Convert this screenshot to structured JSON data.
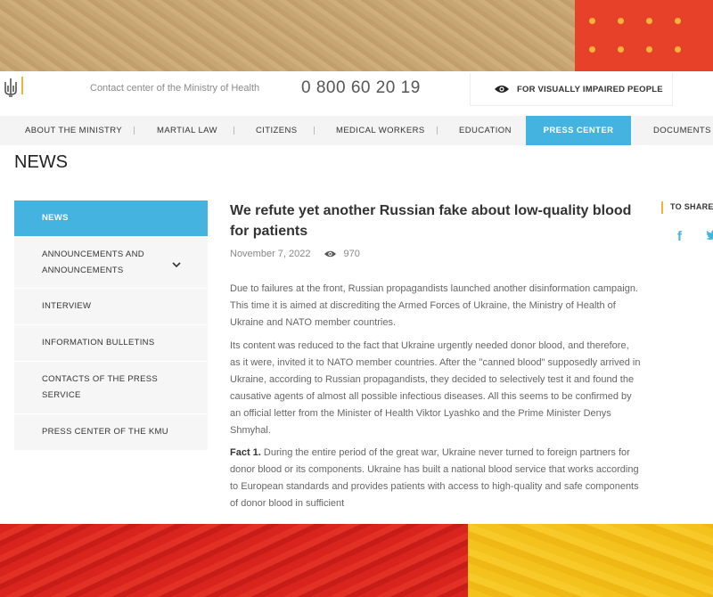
{
  "header": {
    "contact_label": "Contact center of the Ministry of Health",
    "phone": "0 800 60 20 19",
    "visually_impaired": "FOR VISUALLY IMPAIRED PEOPLE"
  },
  "nav": {
    "items": [
      "ABOUT THE MINISTRY",
      "MARTIAL LAW",
      "CITIZENS",
      "MEDICAL WORKERS",
      "EDUCATION",
      "PRESS CENTER",
      "DOCUMENTS"
    ],
    "active": "PRESS CENTER"
  },
  "page_title": "NEWS",
  "sidebar": {
    "items": [
      {
        "label": "NEWS",
        "active": true
      },
      {
        "label": "ANNOUNCEMENTS AND ANNOUNCEMENTS",
        "expandable": true
      },
      {
        "label": "INTERVIEW"
      },
      {
        "label": "INFORMATION BULLETINS"
      },
      {
        "label": "CONTACTS OF THE PRESS SERVICE"
      },
      {
        "label": "PRESS CENTER OF THE KMU"
      }
    ]
  },
  "article": {
    "title": "We refute yet another Russian fake about low-quality blood for patients",
    "date": "November 7, 2022",
    "views": "970",
    "paragraphs": [
      "Due to failures at the front, Russian propagandists launched another disinformation campaign. This time it is aimed at discrediting the Armed Forces of Ukraine, the Ministry of Health of Ukraine and NATO member countries.",
      "Its content was reduced to the fact that Ukraine urgently needed donor blood, and therefore, as it were, invited it to NATO member countries. After the \"canned blood\" supposedly arrived in Ukraine, according to Russian propagandists, they decided to selectively test it and found the causative agents of almost all possible infectious diseases. All this seems to be confirmed by an official letter from the Minister of Health Viktor Lyashko and the Prime Minister Denys Shmyhal."
    ],
    "fact_label": "Fact 1.",
    "fact_text": " During the entire period of the great war, Ukraine never turned to foreign partners for donor blood or its components. Ukraine has built a national blood service that works according to European standards and provides patients with access to high-quality and safe components of donor blood in sufficient"
  },
  "share": {
    "label": "TO SHARE"
  },
  "colors": {
    "accent": "#44b3e0",
    "brand_yellow": "#f2b33a"
  },
  "icons": [
    "trident-icon",
    "eye-icon",
    "chevron-down-icon",
    "views-eye-icon",
    "facebook-icon",
    "twitter-icon"
  ]
}
